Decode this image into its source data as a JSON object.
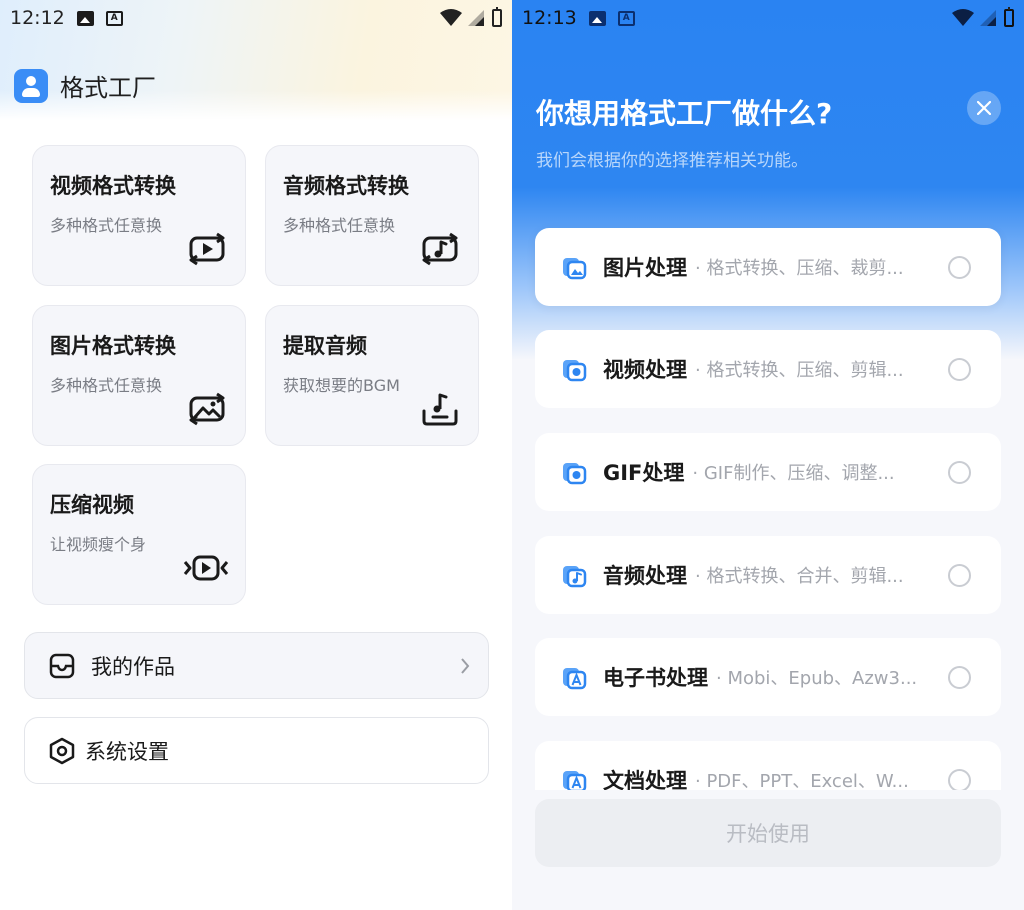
{
  "left": {
    "status": {
      "time": "12:12"
    },
    "app": {
      "name": "格式工厂"
    },
    "cards": [
      {
        "title": "视频格式转换",
        "subtitle": "多种格式任意换",
        "icon": "video-convert-icon"
      },
      {
        "title": "音频格式转换",
        "subtitle": "多种格式任意换",
        "icon": "audio-convert-icon"
      },
      {
        "title": "图片格式转换",
        "subtitle": "多种格式任意换",
        "icon": "image-convert-icon"
      },
      {
        "title": "提取音频",
        "subtitle": "获取想要的BGM",
        "icon": "extract-audio-icon"
      },
      {
        "title": "压缩视频",
        "subtitle": "让视频瘦个身",
        "icon": "compress-video-icon"
      }
    ],
    "rows": {
      "works": "我的作品",
      "settings": "系统设置"
    }
  },
  "right": {
    "status": {
      "time": "12:13"
    },
    "title": "你想用格式工厂做什么?",
    "subtitle": "我们会根据你的选择推荐相关功能。",
    "options": [
      {
        "name": "图片处理",
        "desc": "· 格式转换、压缩、裁剪...",
        "icon": "image-process-icon"
      },
      {
        "name": "视频处理",
        "desc": "· 格式转换、压缩、剪辑...",
        "icon": "video-process-icon"
      },
      {
        "name": "GIF处理",
        "desc": "· GIF制作、压缩、调整...",
        "icon": "gif-process-icon"
      },
      {
        "name": "音频处理",
        "desc": "· 格式转换、合并、剪辑...",
        "icon": "audio-process-icon"
      },
      {
        "name": "电子书处理",
        "desc": "· Mobi、Epub、Azw3...",
        "icon": "ebook-process-icon"
      },
      {
        "name": "文档处理",
        "desc": "· PDF、PPT、Excel、W...",
        "icon": "document-process-icon"
      }
    ],
    "start_label": "开始使用"
  },
  "colors": {
    "accent": "#2e86f1",
    "card_bg": "#f5f6fa",
    "muted_text": "#a3a6ad"
  }
}
